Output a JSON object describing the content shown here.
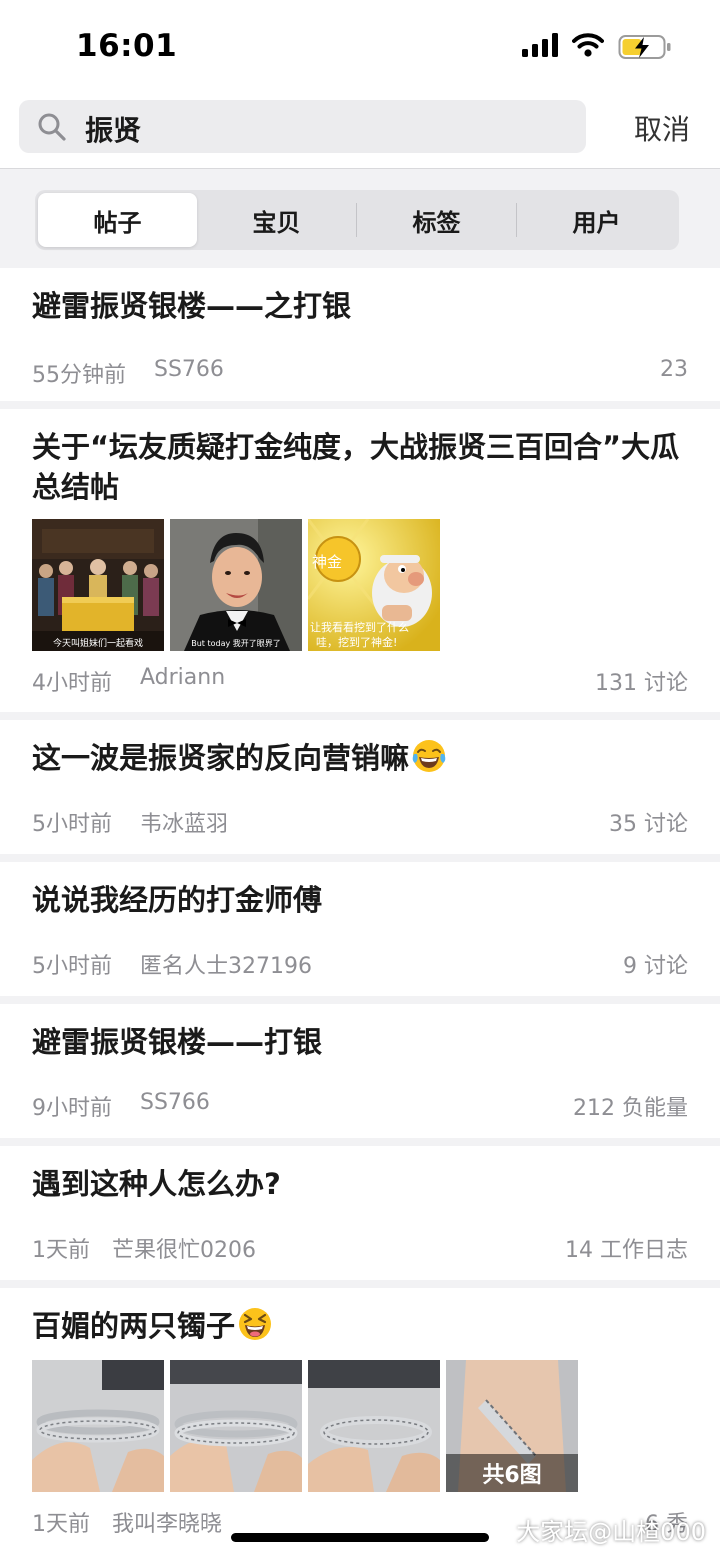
{
  "status_bar": {
    "time": "16:01"
  },
  "search": {
    "query": "振贤",
    "cancel_label": "取消"
  },
  "tabs": [
    {
      "label": "帖子",
      "active": true
    },
    {
      "label": "宝贝",
      "active": false
    },
    {
      "label": "标签",
      "active": false
    },
    {
      "label": "用户",
      "active": false
    }
  ],
  "posts": [
    {
      "title": "避雷振贤银楼——之打银",
      "time": "55分钟前",
      "author": "SS766",
      "right": "23"
    },
    {
      "title": "关于“坛友质疑打金纯度，大战振贤三百回合”大瓜总结帖",
      "time": "4小时前",
      "author": "Adriann",
      "right": "131 讨论",
      "images": [
        {
          "kind": "drama",
          "caption": "今天叫姐妹们一起看戏"
        },
        {
          "kind": "man",
          "caption": "But today 我开了眼界了"
        },
        {
          "kind": "gold",
          "caption_top": "神金",
          "caption_1": "让我看看挖到了什么",
          "caption_2": "哇，挖到了神金!"
        }
      ]
    },
    {
      "title": "这一波是振贤家的反向营销嘛",
      "emoji": "laugh-cry",
      "time": "5小时前",
      "author": "韦冰蓝羽",
      "right": "35 讨论"
    },
    {
      "title": "说说我经历的打金师傅",
      "time": "5小时前",
      "author": "匿名人士327196",
      "right": "9 讨论"
    },
    {
      "title": "避雷振贤银楼——打银",
      "time": "9小时前",
      "author": "SS766",
      "right": "212 负能量"
    },
    {
      "title": "遇到这种人怎么办?",
      "time": "1天前",
      "author": "芒果很忙0206",
      "right": "14 工作日志"
    },
    {
      "title": "百媚的两只镯子",
      "emoji": "grin-squint",
      "time": "1天前",
      "author": "我叫李晓晓",
      "right": "6 秀",
      "images": [
        {
          "kind": "bangle"
        },
        {
          "kind": "bangle"
        },
        {
          "kind": "bangle"
        },
        {
          "kind": "wrist",
          "overlay": "共6图"
        }
      ]
    }
  ],
  "watermark": "大家坛@山楂000"
}
